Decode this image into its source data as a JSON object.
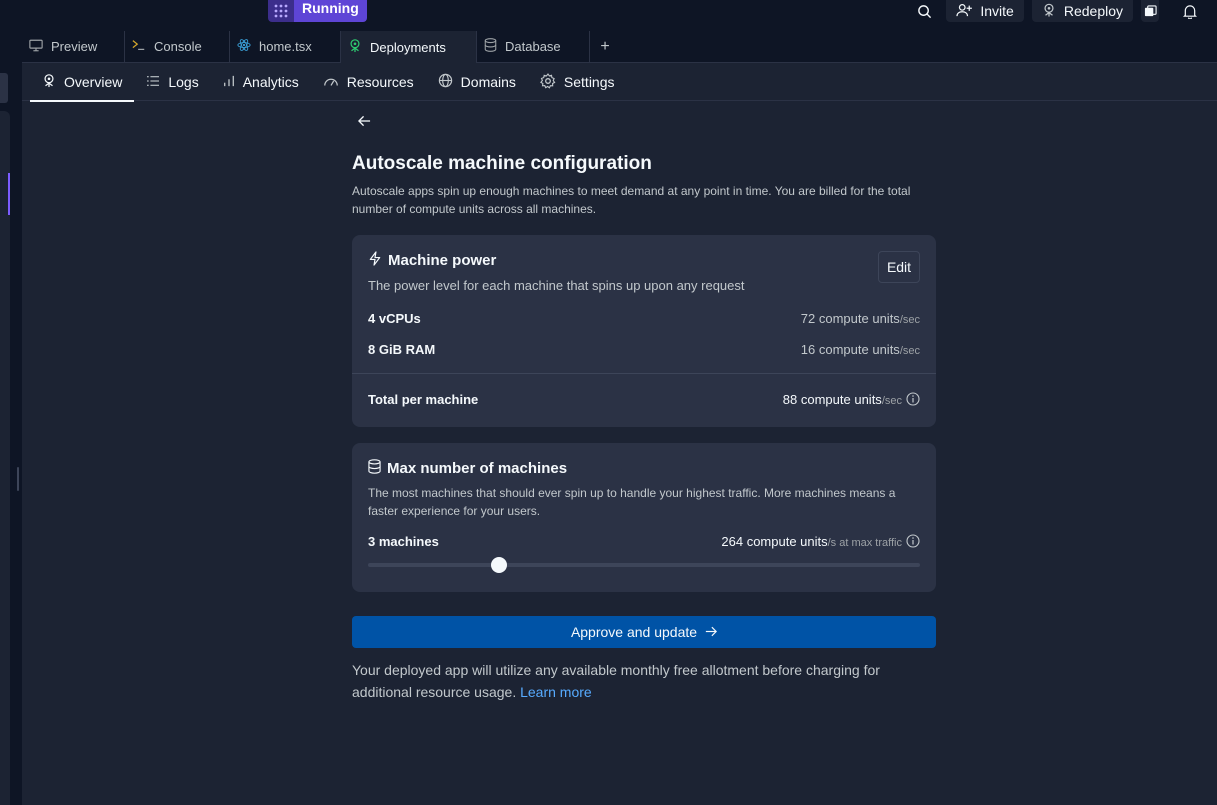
{
  "topbar": {
    "run_label": "Running",
    "invite_label": "Invite",
    "redeploy_label": "Redeploy"
  },
  "tabs": [
    {
      "label": "Preview",
      "icon": "monitor-icon"
    },
    {
      "label": "Console",
      "icon": "terminal-icon"
    },
    {
      "label": "home.tsx",
      "icon": "react-icon"
    },
    {
      "label": "Deployments",
      "icon": "deployments-icon",
      "active": true
    },
    {
      "label": "Database",
      "icon": "database-icon"
    }
  ],
  "subnav": [
    {
      "label": "Overview",
      "icon": "deployments-icon",
      "active": true
    },
    {
      "label": "Logs",
      "icon": "list-icon"
    },
    {
      "label": "Analytics",
      "icon": "bar-chart-icon"
    },
    {
      "label": "Resources",
      "icon": "gauge-icon"
    },
    {
      "label": "Domains",
      "icon": "globe-icon"
    },
    {
      "label": "Settings",
      "icon": "gear-icon"
    }
  ],
  "page": {
    "title": "Autoscale machine configuration",
    "description": "Autoscale apps spin up enough machines to meet demand at any point in time. You are billed for the total number of compute units across all machines."
  },
  "machine_power": {
    "title": "Machine power",
    "subtitle": "The power level for each machine that spins up upon any request",
    "edit_label": "Edit",
    "rows": [
      {
        "label": "4 vCPUs",
        "value": "72 compute units",
        "unit": "/sec"
      },
      {
        "label": "8 GiB RAM",
        "value": "16 compute units",
        "unit": "/sec"
      }
    ],
    "total_label": "Total per machine",
    "total_value": "88 compute units",
    "total_unit": "/sec"
  },
  "max_machines": {
    "title": "Max number of machines",
    "subtitle": "The most machines that should ever spin up to handle your highest traffic. More machines means a faster experience for your users.",
    "count_label": "3 machines",
    "value": "264 compute units",
    "unit": "/s at max traffic",
    "slider_fraction": 0.23
  },
  "approve_label": "Approve and update",
  "footer_text": "Your deployed app will utilize any available monthly free allotment before charging for additional resource usage. ",
  "learn_more": "Learn more",
  "colors": {
    "accent": "#5e45d6",
    "primary_button": "#0053a6",
    "link": "#57abff"
  }
}
